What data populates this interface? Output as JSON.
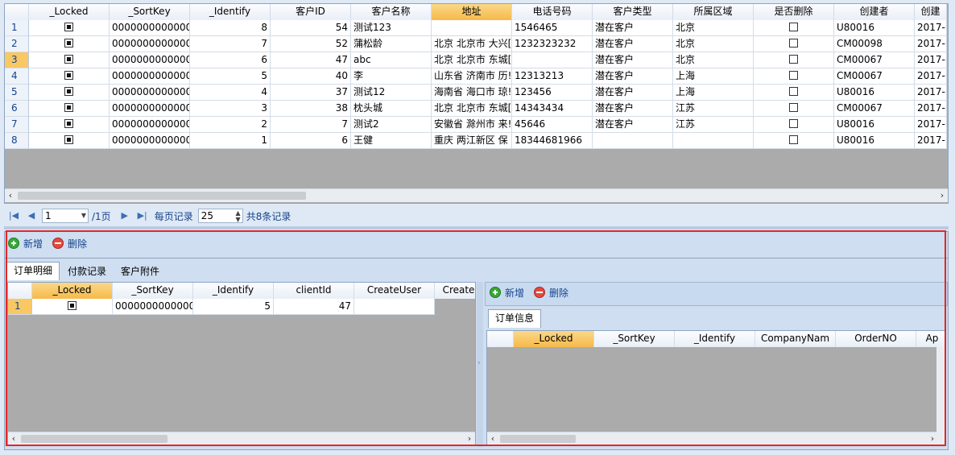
{
  "top_grid": {
    "columns": [
      "_Locked",
      "_SortKey",
      "_Identify",
      "客户ID",
      "客户名称",
      "地址",
      "电话号码",
      "客户类型",
      "所属区域",
      "是否删除",
      "创建者",
      "创建"
    ],
    "rows": [
      {
        "n": "1",
        "sort": "0000000000000",
        "ident": "8",
        "id": "54",
        "name": "测试123",
        "addr": "",
        "phone": "1546465",
        "type": "潜在客户",
        "region": "北京",
        "creator": "U80016",
        "date": "2017-("
      },
      {
        "n": "2",
        "sort": "0000000000000",
        "ident": "7",
        "id": "52",
        "name": "蒲松龄",
        "addr": "北京 北京市 大兴[",
        "phone": "1232323232",
        "type": "潜在客户",
        "region": "北京",
        "creator": "CM00098",
        "date": "2017-("
      },
      {
        "n": "3",
        "sort": "0000000000000",
        "ident": "6",
        "id": "47",
        "name": "abc",
        "addr": "北京 北京市 东城[",
        "phone": "",
        "type": "潜在客户",
        "region": "北京",
        "creator": "CM00067",
        "date": "2017-("
      },
      {
        "n": "4",
        "sort": "0000000000000",
        "ident": "5",
        "id": "40",
        "name": "李",
        "addr": "山东省 济南市 历!",
        "phone": "12313213",
        "type": "潜在客户",
        "region": "上海",
        "creator": "CM00067",
        "date": "2017-("
      },
      {
        "n": "5",
        "sort": "0000000000000",
        "ident": "4",
        "id": "37",
        "name": "测试12",
        "addr": "海南省 海口市 琼!",
        "phone": "123456",
        "type": "潜在客户",
        "region": "上海",
        "creator": "U80016",
        "date": "2017-("
      },
      {
        "n": "6",
        "sort": "0000000000000",
        "ident": "3",
        "id": "38",
        "name": "枕头城",
        "addr": "北京 北京市 东城[",
        "phone": "14343434",
        "type": "潜在客户",
        "region": "江苏",
        "creator": "CM00067",
        "date": "2017-("
      },
      {
        "n": "7",
        "sort": "0000000000000",
        "ident": "2",
        "id": "7",
        "name": "测试2",
        "addr": "安徽省 滁州市 来!",
        "phone": "45646",
        "type": "潜在客户",
        "region": "江苏",
        "creator": "U80016",
        "date": "2017-("
      },
      {
        "n": "8",
        "sort": "0000000000000",
        "ident": "1",
        "id": "6",
        "name": "王健",
        "addr": "重庆 两江新区 保",
        "phone": "18344681966",
        "type": "",
        "region": "",
        "creator": "U80016",
        "date": "2017-("
      }
    ]
  },
  "pager": {
    "page": "1",
    "total_pages": "/1页",
    "per_page_label": "每页记录",
    "per_page": "25",
    "total": "共8条记录"
  },
  "detail_toolbar": {
    "add": "新增",
    "delete": "删除"
  },
  "detail_tabs": [
    "订单明细",
    "付款记录",
    "客户附件"
  ],
  "order_grid": {
    "columns": [
      "_Locked",
      "_SortKey",
      "_Identify",
      "clientId",
      "CreateUser",
      "Create"
    ],
    "rows": [
      {
        "n": "1",
        "sort": "0000000000000",
        "ident": "5",
        "client": "47",
        "user": ""
      }
    ]
  },
  "right_toolbar": {
    "add": "新增",
    "delete": "删除"
  },
  "right_tabs": [
    "订单信息"
  ],
  "info_grid": {
    "columns": [
      "_Locked",
      "_SortKey",
      "_Identify",
      "CompanyNam",
      "OrderNO",
      "Ap"
    ]
  }
}
